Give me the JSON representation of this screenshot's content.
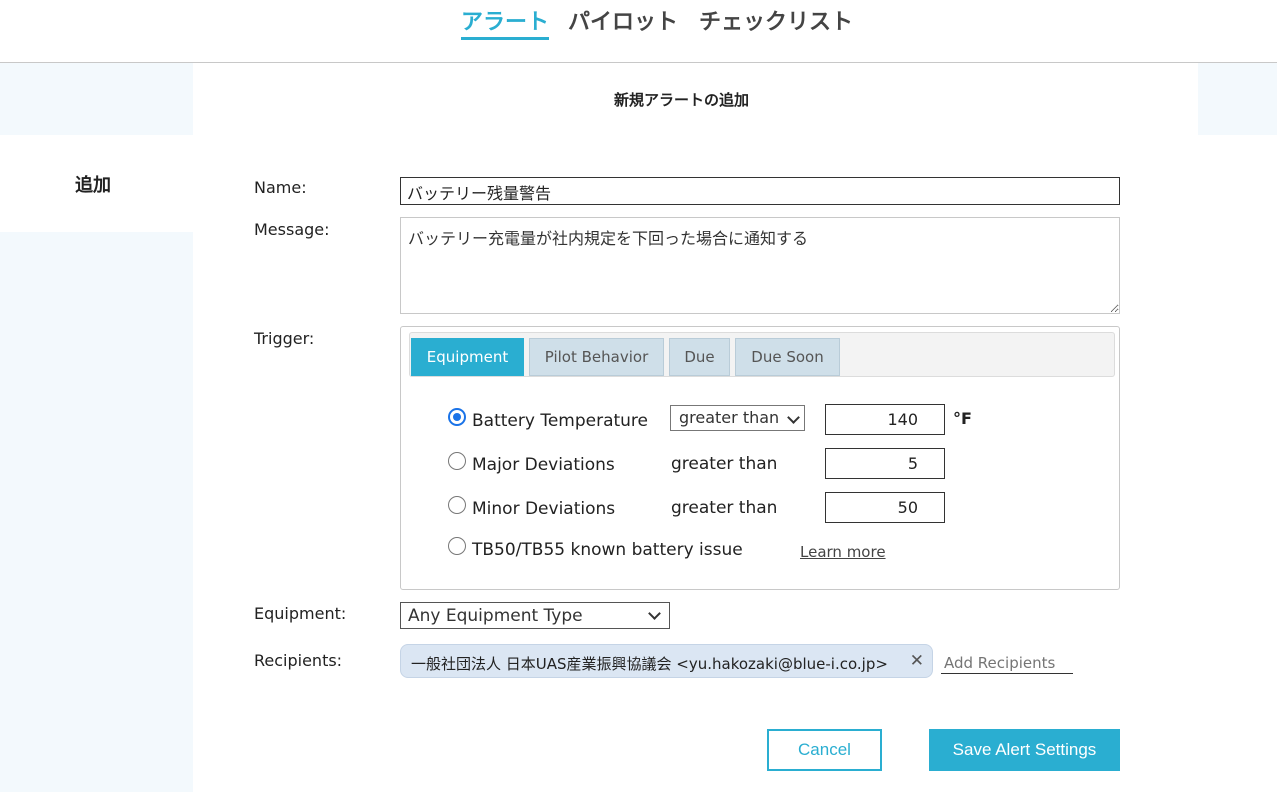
{
  "nav": {
    "tabs": [
      {
        "label": "アラート",
        "active": true
      },
      {
        "label": "パイロット",
        "active": false
      },
      {
        "label": "チェックリスト",
        "active": false
      }
    ]
  },
  "sidebar": {
    "label": "追加"
  },
  "form": {
    "title": "新規アラートの追加",
    "name_label": "Name:",
    "name_value": "バッテリー残量警告",
    "message_label": "Message:",
    "message_value": "バッテリー充電量が社内規定を下回った場合に通知する",
    "trigger_label": "Trigger:",
    "equipment_label": "Equipment:",
    "equipment_value": "Any Equipment Type",
    "recipients_label": "Recipients:",
    "recipient_chip": "一般社団法人 日本UAS産業振興協議会 <yu.hakozaki@blue-i.co.jp>",
    "add_recipients_placeholder": "Add Recipients",
    "cancel_label": "Cancel",
    "save_label": "Save Alert Settings"
  },
  "trigger": {
    "tabs": [
      {
        "label": "Equipment",
        "active": true
      },
      {
        "label": "Pilot Behavior",
        "active": false
      },
      {
        "label": "Due",
        "active": false
      },
      {
        "label": "Due Soon",
        "active": false
      }
    ],
    "options": [
      {
        "label": "Battery Temperature",
        "checked": true,
        "comparison": "greater than",
        "value": "140",
        "unit": "°F"
      },
      {
        "label": "Major Deviations",
        "checked": false,
        "comparison": "greater than",
        "value": "5"
      },
      {
        "label": "Minor Deviations",
        "checked": false,
        "comparison": "greater than",
        "value": "50"
      },
      {
        "label": "TB50/TB55 known battery issue",
        "checked": false,
        "link": "Learn more"
      }
    ]
  },
  "colors": {
    "accent": "#2aaed1",
    "panel_bg": "#f3f9fd",
    "chip_bg": "#dbe6f3"
  }
}
